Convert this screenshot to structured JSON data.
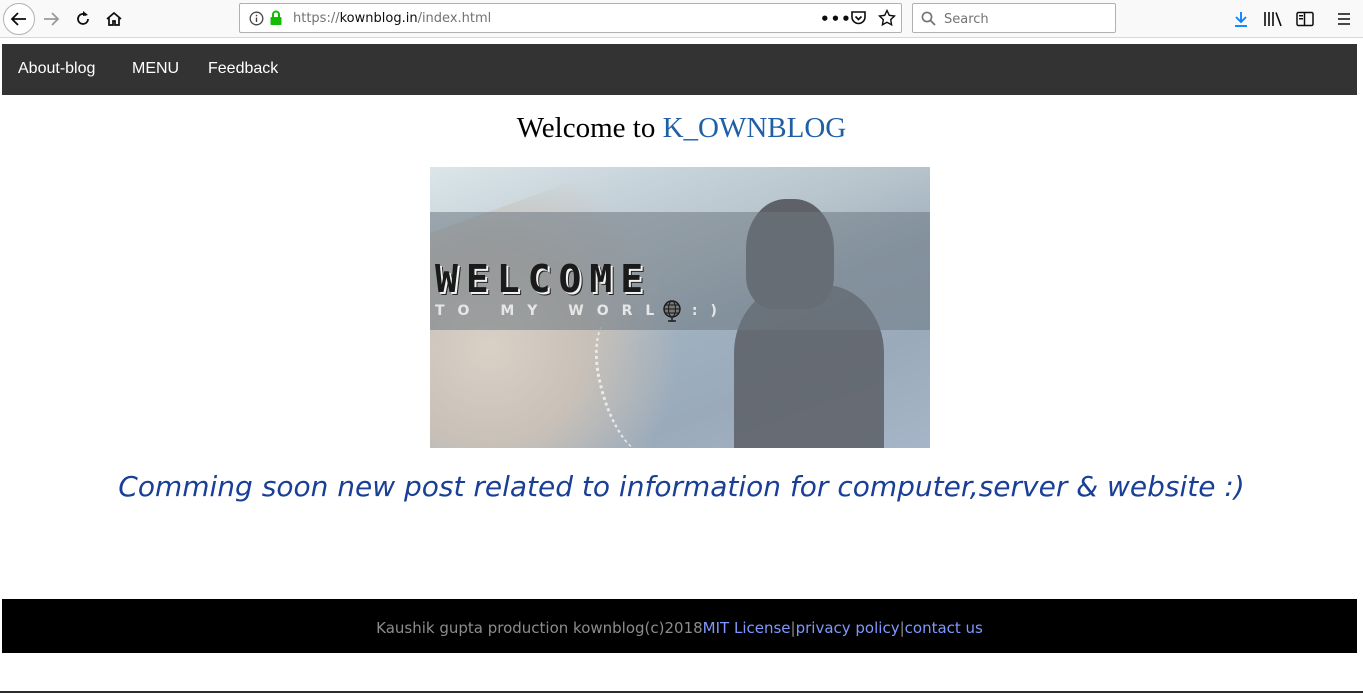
{
  "browser": {
    "url_prefix": "https://",
    "url_domain": "kownblog.in",
    "url_path": "/index.html",
    "search_placeholder": "Search"
  },
  "nav": {
    "items": [
      {
        "label": "About-blog"
      },
      {
        "label": "MENU"
      },
      {
        "label": "Feedback"
      }
    ]
  },
  "main": {
    "title_prefix": "Welcome to ",
    "title_brand": "K_OWNBLOG",
    "hero_heading": "WELCOME",
    "hero_subheading": "TO MY WORLD:)",
    "tagline": "Comming soon new post related to information for computer,server & website :)"
  },
  "footer": {
    "copyright": "Kaushik gupta production kownblog(c)2018",
    "license_link": "MIT License",
    "separator": "|",
    "privacy_link": "privacy policy",
    "contact_link": "contact us"
  },
  "colors": {
    "navbar_bg": "#333333",
    "brand_blue": "#1f5fa6",
    "tagline_blue": "#1a3f96",
    "footer_bg": "#000000",
    "footer_link": "#7f98ff",
    "download_icon": "#0a84ff",
    "secure_lock": "#12bc00"
  }
}
